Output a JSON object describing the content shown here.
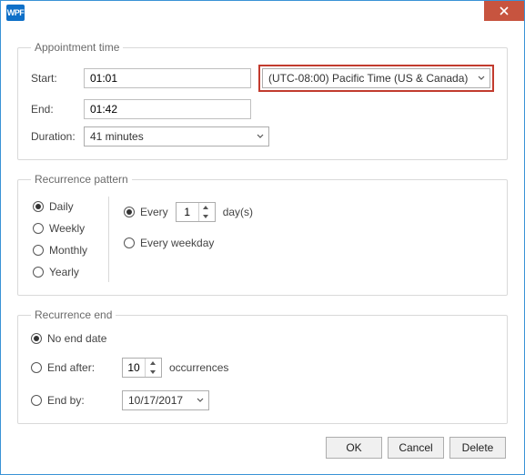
{
  "window": {
    "app_badge": "WPF"
  },
  "appt": {
    "legend": "Appointment time",
    "start_label": "Start:",
    "start_value": "01:01",
    "end_label": "End:",
    "end_value": "01:42",
    "duration_label": "Duration:",
    "duration_value": "41 minutes",
    "timezone_value": "(UTC-08:00) Pacific Time (US & Canada)"
  },
  "pattern": {
    "legend": "Recurrence pattern",
    "daily": "Daily",
    "weekly": "Weekly",
    "monthly": "Monthly",
    "yearly": "Yearly",
    "every": "Every",
    "n": "1",
    "days_suffix": "day(s)",
    "every_weekday": "Every weekday"
  },
  "end": {
    "legend": "Recurrence end",
    "no_end": "No end date",
    "end_after": "End after:",
    "occ_n": "10",
    "occurrences": "occurrences",
    "end_by": "End by:",
    "date": "10/17/2017"
  },
  "footer": {
    "ok": "OK",
    "cancel": "Cancel",
    "del": "Delete"
  }
}
